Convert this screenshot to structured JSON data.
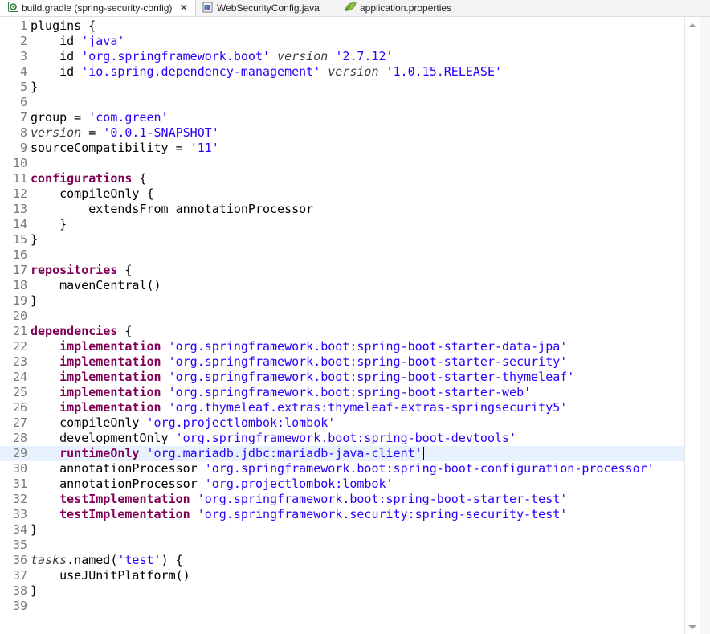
{
  "tabs": [
    {
      "label": "build.gradle (spring-security-config)",
      "close": "✕",
      "icon": "gradle-file-icon"
    },
    {
      "label": "WebSecurityConfig.java",
      "icon": "java-file-icon"
    },
    {
      "label": "application.properties",
      "icon": "properties-file-icon"
    }
  ],
  "lines": [
    {
      "n": "1",
      "t": [
        [
          "plugins {",
          ""
        ]
      ]
    },
    {
      "n": "2",
      "t": [
        [
          "    id ",
          ""
        ],
        [
          "'java'",
          "str"
        ]
      ]
    },
    {
      "n": "3",
      "t": [
        [
          "    id ",
          ""
        ],
        [
          "'org.springframework.boot'",
          "str"
        ],
        [
          " ",
          ""
        ],
        [
          "version",
          "it"
        ],
        [
          " ",
          ""
        ],
        [
          "'2.7.12'",
          "str"
        ]
      ]
    },
    {
      "n": "4",
      "t": [
        [
          "    id ",
          ""
        ],
        [
          "'io.spring.dependency-management'",
          "str"
        ],
        [
          " ",
          ""
        ],
        [
          "version",
          "it"
        ],
        [
          " ",
          ""
        ],
        [
          "'1.0.15.RELEASE'",
          "str"
        ]
      ]
    },
    {
      "n": "5",
      "t": [
        [
          "}",
          ""
        ]
      ]
    },
    {
      "n": "6",
      "t": []
    },
    {
      "n": "7",
      "t": [
        [
          "group = ",
          ""
        ],
        [
          "'com.green'",
          "str"
        ]
      ]
    },
    {
      "n": "8",
      "t": [
        [
          "version",
          "it"
        ],
        [
          " = ",
          ""
        ],
        [
          "'0.0.1-SNAPSHOT'",
          "str"
        ]
      ]
    },
    {
      "n": "9",
      "t": [
        [
          "sourceCompatibility = ",
          ""
        ],
        [
          "'11'",
          "str"
        ]
      ]
    },
    {
      "n": "10",
      "t": []
    },
    {
      "n": "11",
      "t": [
        [
          "configurations",
          "kw"
        ],
        [
          " {",
          ""
        ]
      ]
    },
    {
      "n": "12",
      "t": [
        [
          "    compileOnly {",
          ""
        ]
      ]
    },
    {
      "n": "13",
      "t": [
        [
          "        extendsFrom annotationProcessor",
          ""
        ]
      ]
    },
    {
      "n": "14",
      "t": [
        [
          "    }",
          ""
        ]
      ]
    },
    {
      "n": "15",
      "t": [
        [
          "}",
          ""
        ]
      ]
    },
    {
      "n": "16",
      "t": []
    },
    {
      "n": "17",
      "t": [
        [
          "repositories",
          "kw"
        ],
        [
          " {",
          ""
        ]
      ]
    },
    {
      "n": "18",
      "t": [
        [
          "    mavenCentral()",
          ""
        ]
      ]
    },
    {
      "n": "19",
      "t": [
        [
          "}",
          ""
        ]
      ]
    },
    {
      "n": "20",
      "t": []
    },
    {
      "n": "21",
      "t": [
        [
          "dependencies",
          "kw"
        ],
        [
          " {",
          ""
        ]
      ]
    },
    {
      "n": "22",
      "t": [
        [
          "    ",
          ""
        ],
        [
          "implementation",
          "kw"
        ],
        [
          " ",
          ""
        ],
        [
          "'org.springframework.boot:spring-boot-starter-data-jpa'",
          "str"
        ]
      ]
    },
    {
      "n": "23",
      "t": [
        [
          "    ",
          ""
        ],
        [
          "implementation",
          "kw"
        ],
        [
          " ",
          ""
        ],
        [
          "'org.springframework.boot:spring-boot-starter-security'",
          "str"
        ]
      ]
    },
    {
      "n": "24",
      "t": [
        [
          "    ",
          ""
        ],
        [
          "implementation",
          "kw"
        ],
        [
          " ",
          ""
        ],
        [
          "'org.springframework.boot:spring-boot-starter-thymeleaf'",
          "str"
        ]
      ]
    },
    {
      "n": "25",
      "t": [
        [
          "    ",
          ""
        ],
        [
          "implementation",
          "kw"
        ],
        [
          " ",
          ""
        ],
        [
          "'org.springframework.boot:spring-boot-starter-web'",
          "str"
        ]
      ]
    },
    {
      "n": "26",
      "t": [
        [
          "    ",
          ""
        ],
        [
          "implementation",
          "kw"
        ],
        [
          " ",
          ""
        ],
        [
          "'org.thymeleaf.extras:thymeleaf-extras-springsecurity5'",
          "str"
        ]
      ]
    },
    {
      "n": "27",
      "t": [
        [
          "    compileOnly ",
          ""
        ],
        [
          "'org.projectlombok:lombok'",
          "str"
        ]
      ]
    },
    {
      "n": "28",
      "t": [
        [
          "    developmentOnly ",
          ""
        ],
        [
          "'org.springframework.boot:spring-boot-devtools'",
          "str"
        ]
      ]
    },
    {
      "n": "29",
      "t": [
        [
          "    ",
          ""
        ],
        [
          "runtimeOnly",
          "kw"
        ],
        [
          " ",
          ""
        ],
        [
          "'org.mariadb.jdbc:mariadb-java-client'",
          "str"
        ]
      ],
      "current": true
    },
    {
      "n": "30",
      "t": [
        [
          "    annotationProcessor ",
          ""
        ],
        [
          "'org.springframework.boot:spring-boot-configuration-processor'",
          "str"
        ]
      ]
    },
    {
      "n": "31",
      "t": [
        [
          "    annotationProcessor ",
          ""
        ],
        [
          "'org.projectlombok:lombok'",
          "str"
        ]
      ]
    },
    {
      "n": "32",
      "t": [
        [
          "    ",
          ""
        ],
        [
          "testImplementation",
          "kw"
        ],
        [
          " ",
          ""
        ],
        [
          "'org.springframework.boot:spring-boot-starter-test'",
          "str"
        ]
      ]
    },
    {
      "n": "33",
      "t": [
        [
          "    ",
          ""
        ],
        [
          "testImplementation",
          "kw"
        ],
        [
          " ",
          ""
        ],
        [
          "'org.springframework.security:spring-security-test'",
          "str"
        ]
      ]
    },
    {
      "n": "34",
      "t": [
        [
          "}",
          ""
        ]
      ]
    },
    {
      "n": "35",
      "t": []
    },
    {
      "n": "36",
      "t": [
        [
          "tasks",
          "it"
        ],
        [
          ".named(",
          ""
        ],
        [
          "'test'",
          "str"
        ],
        [
          ") {",
          ""
        ]
      ]
    },
    {
      "n": "37",
      "t": [
        [
          "    useJUnitPlatform()",
          ""
        ]
      ]
    },
    {
      "n": "38",
      "t": [
        [
          "}",
          ""
        ]
      ]
    },
    {
      "n": "39",
      "t": []
    }
  ]
}
